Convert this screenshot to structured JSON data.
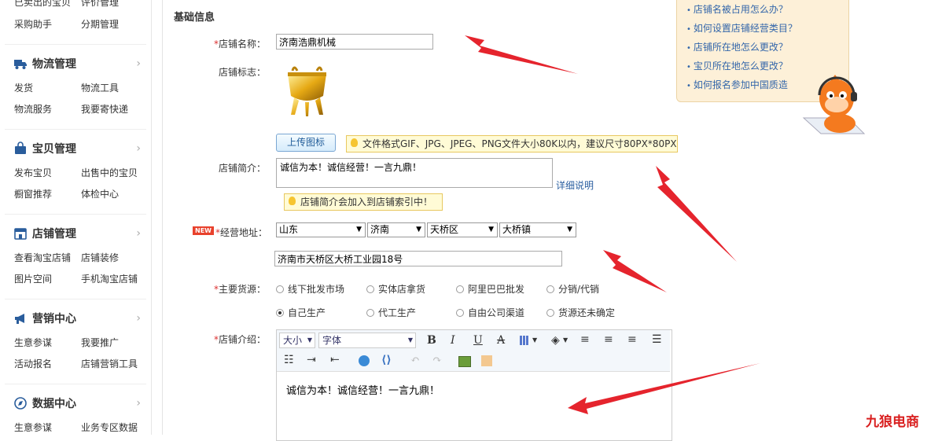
{
  "sidebar": {
    "top_links": [
      "已卖出的宝贝",
      "评价管理",
      "采购助手",
      "分期管理"
    ],
    "sections": [
      {
        "title": "物流管理",
        "icon": "truck-icon",
        "links": [
          "发货",
          "物流工具",
          "物流服务",
          "我要寄快递"
        ]
      },
      {
        "title": "宝贝管理",
        "icon": "bag-icon",
        "links": [
          "发布宝贝",
          "出售中的宝贝",
          "橱窗推荐",
          "体检中心"
        ]
      },
      {
        "title": "店铺管理",
        "icon": "shop-icon",
        "links": [
          "查看淘宝店铺",
          "店铺装修",
          "图片空间",
          "手机淘宝店铺"
        ]
      },
      {
        "title": "营销中心",
        "icon": "megaphone-icon",
        "links": [
          "生意参谋",
          "我要推广",
          "活动报名",
          "店铺营销工具"
        ]
      },
      {
        "title": "数据中心",
        "icon": "compass-icon",
        "links": [
          "生意参谋",
          "业务专区数据"
        ]
      }
    ]
  },
  "form": {
    "section_title": "基础信息",
    "shop_name": {
      "label": "店铺名称：",
      "value": "济南浩鼎机械"
    },
    "shop_logo": {
      "label": "店铺标志：",
      "upload_button": "上传图标",
      "tip": "文件格式GIF、JPG、JPEG、PNG文件大小80K以内，建议尺寸80PX*80PX"
    },
    "shop_intro": {
      "label": "店铺简介：",
      "value": "诚信为本！诚信经营！一言九鼎！",
      "detail_link": "详细说明",
      "tip": "店铺简介会加入到店铺索引中！"
    },
    "address": {
      "badge": "NEW",
      "label": "经营地址：",
      "province": "山东",
      "city": "济南",
      "district": "天桥区",
      "town": "大桥镇",
      "street": "济南市天桥区大桥工业园18号"
    },
    "source": {
      "label": "主要货源：",
      "options": [
        "线下批发市场",
        "实体店拿货",
        "阿里巴巴批发",
        "分销/代销",
        "自己生产",
        "代工生产",
        "自由公司渠道",
        "货源还未确定"
      ],
      "selected": "自己生产"
    },
    "description": {
      "label": "店铺介绍：",
      "size_select": "大小",
      "font_select": "字体",
      "content": "诚信为本！诚信经营！一言九鼎！"
    }
  },
  "help": {
    "items": [
      "店铺名被占用怎么办？",
      "如何设置店铺经营类目？",
      "店铺所在地怎么更改？",
      "宝贝所在地怎么更改？",
      "如何报名参加中国质造"
    ]
  },
  "watermark": "九狼电商"
}
